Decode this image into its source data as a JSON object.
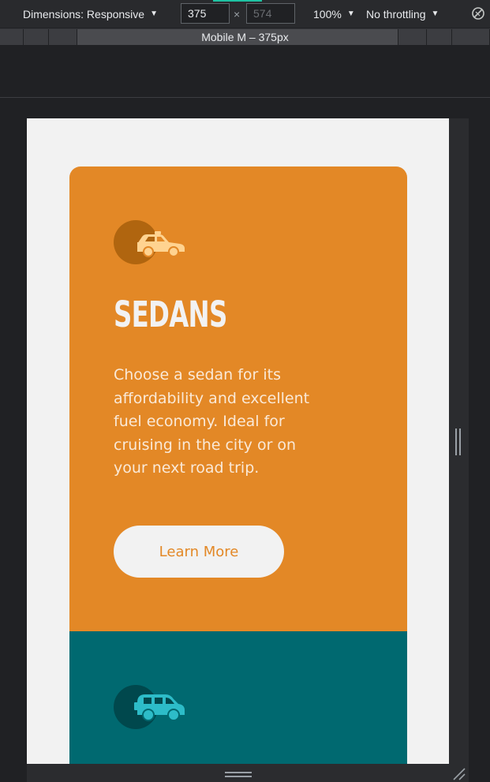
{
  "devtools": {
    "dimensions_label": "Dimensions: Responsive",
    "width_value": "375",
    "times_symbol": "×",
    "height_value": "574",
    "zoom_label": "100%",
    "throttle_label": "No throttling",
    "device_label": "Mobile M – 375px"
  },
  "cards": {
    "sedans": {
      "title": "SEDANS",
      "description": "Choose a sedan for its affordability and excellent fuel economy. Ideal for cruising in the city or on your next road trip.",
      "button_label": "Learn More",
      "accent_color": "#e38826",
      "icon": "sedan-car-icon"
    },
    "suvs": {
      "accent_color": "#006970",
      "icon": "suv-car-icon"
    }
  },
  "colors": {
    "page_background": "#f2f2f2",
    "devtools_background": "#202124"
  }
}
